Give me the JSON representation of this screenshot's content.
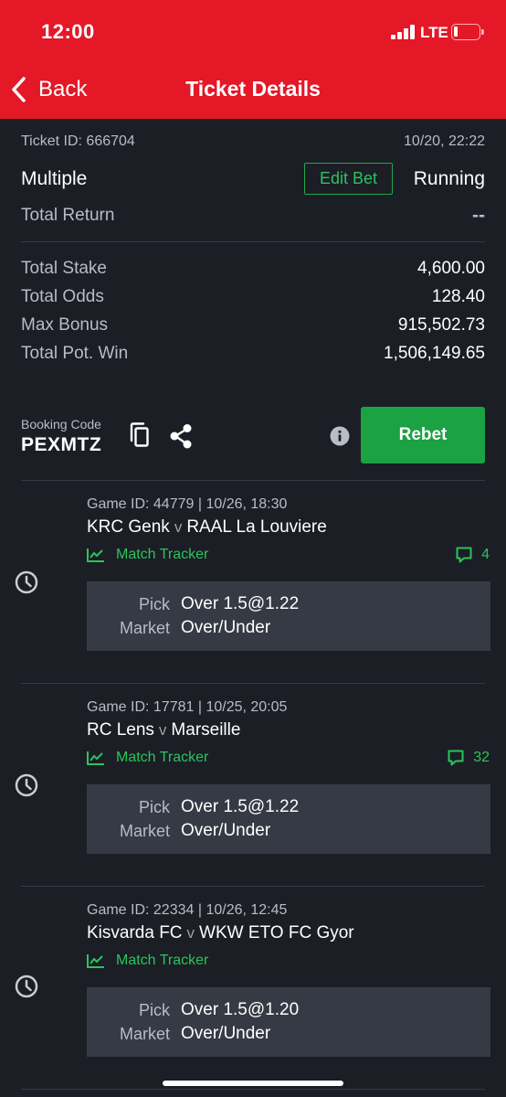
{
  "status_bar": {
    "time": "12:00",
    "network": "LTE"
  },
  "nav": {
    "back_label": "Back",
    "title": "Ticket Details"
  },
  "ticket": {
    "id_label": "Ticket ID: 666704",
    "datetime": "10/20, 22:22",
    "type": "Multiple",
    "edit_bet_label": "Edit Bet",
    "status": "Running",
    "total_return_label": "Total Return",
    "total_return_value": "--",
    "stats": [
      {
        "label": "Total Stake",
        "value": "4,600.00"
      },
      {
        "label": "Total Odds",
        "value": "128.40"
      },
      {
        "label": "Max Bonus",
        "value": "915,502.73"
      },
      {
        "label": "Total Pot. Win",
        "value": "1,506,149.65"
      }
    ]
  },
  "booking": {
    "label": "Booking Code",
    "code": "PEXMTZ",
    "rebet_label": "Rebet"
  },
  "bets": [
    {
      "game_line": "Game ID: 44779 | 10/26, 18:30",
      "home": "KRC Genk",
      "sep": "v",
      "away": "RAAL La Louviere",
      "tracker_label": "Match Tracker",
      "comments": "4",
      "pick_label": "Pick",
      "pick_value": "Over 1.5@1.22",
      "market_label": "Market",
      "market_value": "Over/Under"
    },
    {
      "game_line": "Game ID: 17781 | 10/25, 20:05",
      "home": "RC Lens",
      "sep": "v",
      "away": "Marseille",
      "tracker_label": "Match Tracker",
      "comments": "32",
      "pick_label": "Pick",
      "pick_value": "Over 1.5@1.22",
      "market_label": "Market",
      "market_value": "Over/Under"
    },
    {
      "game_line": "Game ID: 22334 | 10/26, 12:45",
      "home": "Kisvarda FC",
      "sep": "v",
      "away": "WKW ETO FC Gyor",
      "tracker_label": "Match Tracker",
      "pick_label": "Pick",
      "pick_value": "Over 1.5@1.20",
      "market_label": "Market",
      "market_value": "Over/Under"
    }
  ],
  "colors": {
    "brand_red": "#e41827",
    "accent_green": "#1aa243",
    "background": "#1b1e25",
    "panel": "#363a44"
  }
}
